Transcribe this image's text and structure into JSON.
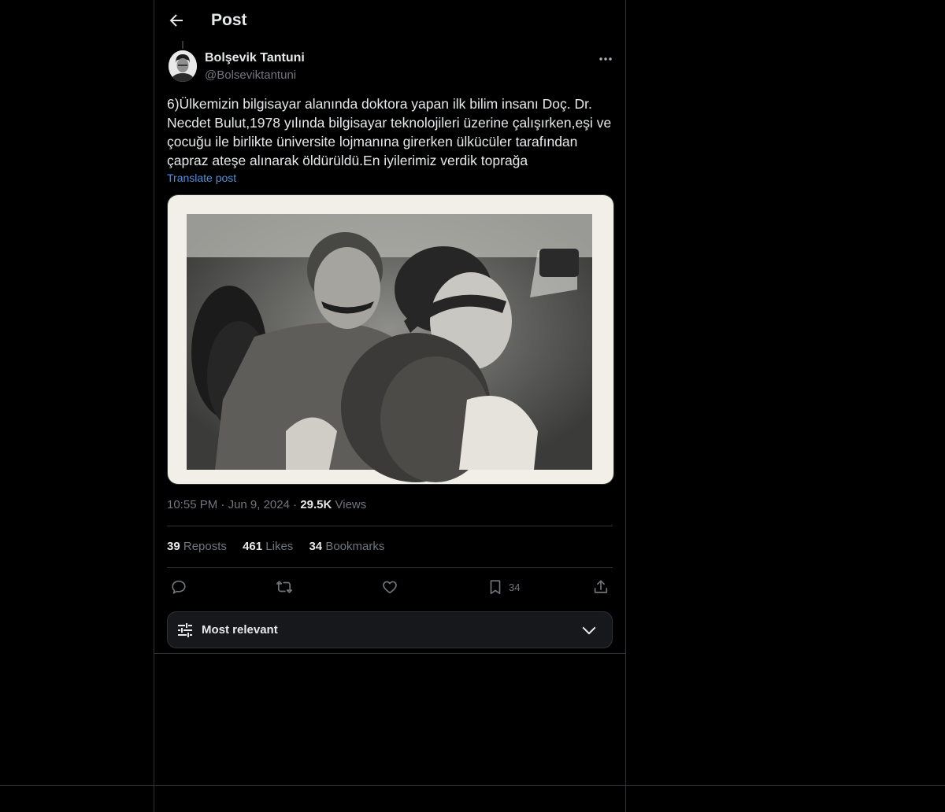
{
  "header": {
    "title": "Post"
  },
  "author": {
    "name": "Bolşevik Tantuni",
    "handle": "@Bolseviktantuni"
  },
  "post": {
    "text": "6)Ülkemizin bilgisayar alanında doktora yapan ilk bilim insanı Doç. Dr. Necdet Bulut,1978 yılında bilgisayar teknolojileri üzerine çalışırken,eşi ve çocuğu ile birlikte üniversite lojmanına girerken ülkücüler tarafından çapraz ateşe alınarak öldürüldü.En iyilerimiz verdik toprağa",
    "translate_label": "Translate post",
    "time": "10:55 PM",
    "dot": "·",
    "date": "Jun 9, 2024",
    "views_count": "29.5K",
    "views_label": "Views"
  },
  "stats": {
    "reposts_count": "39",
    "reposts_label": "Reposts",
    "likes_count": "461",
    "likes_label": "Likes",
    "bookmarks_count": "34",
    "bookmarks_label": "Bookmarks"
  },
  "actions": {
    "bookmark_count": "34"
  },
  "sort": {
    "label": "Most relevant"
  },
  "icons": [
    "back-arrow-icon",
    "more-icon",
    "reply-icon",
    "repost-icon",
    "like-icon",
    "bookmark-icon",
    "share-icon",
    "sliders-icon",
    "chevron-down-icon"
  ],
  "colors": {
    "background": "#000000",
    "text": "#e7e9ea",
    "muted": "#71767b",
    "link": "#4f8fd8",
    "border": "#2f3336"
  }
}
